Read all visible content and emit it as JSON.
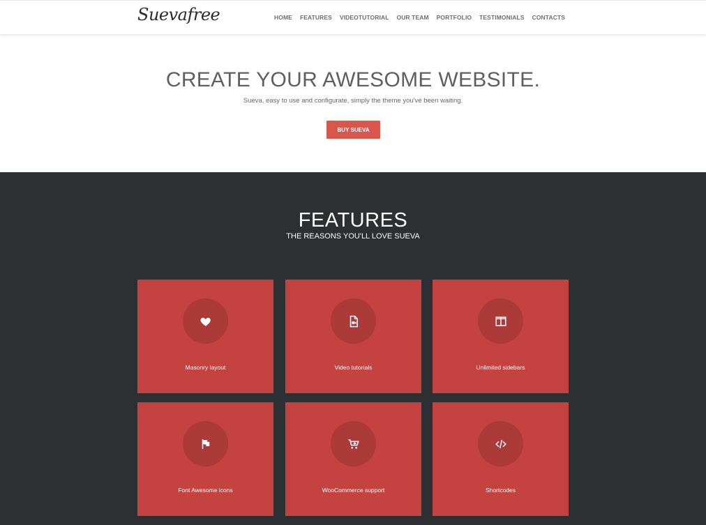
{
  "header": {
    "logo": "Suevafree",
    "nav": [
      "HOME",
      "FEATURES",
      "VIDEOTUTORIAL",
      "OUR TEAM",
      "PORTFOLIO",
      "TESTIMONIALS",
      "CONTACTS"
    ]
  },
  "hero": {
    "title": "CREATE YOUR AWESOME WEBSITE.",
    "tagline": "Sueva, easy to use and configurate, simply the theme you've been waiting.",
    "button_label": "BUY SUEVA"
  },
  "features": {
    "title": "FEATURES",
    "subtitle": "THE REASONS YOU'LL LOVE SUEVA",
    "items": [
      {
        "label": "Masonry layout",
        "icon": "heart-icon"
      },
      {
        "label": "Video tutorials",
        "icon": "video-file-icon"
      },
      {
        "label": "Unlimited sidebars",
        "icon": "columns-icon"
      },
      {
        "label": "Font Awesome icons",
        "icon": "flag-icon"
      },
      {
        "label": "WooCommerce support",
        "icon": "cart-icon"
      },
      {
        "label": "Shortcodes",
        "icon": "code-icon"
      }
    ]
  },
  "colors": {
    "accent": "#d9574a",
    "card": "#c44240",
    "card_circle": "#ac3a38",
    "dark_section": "#2d3033"
  }
}
